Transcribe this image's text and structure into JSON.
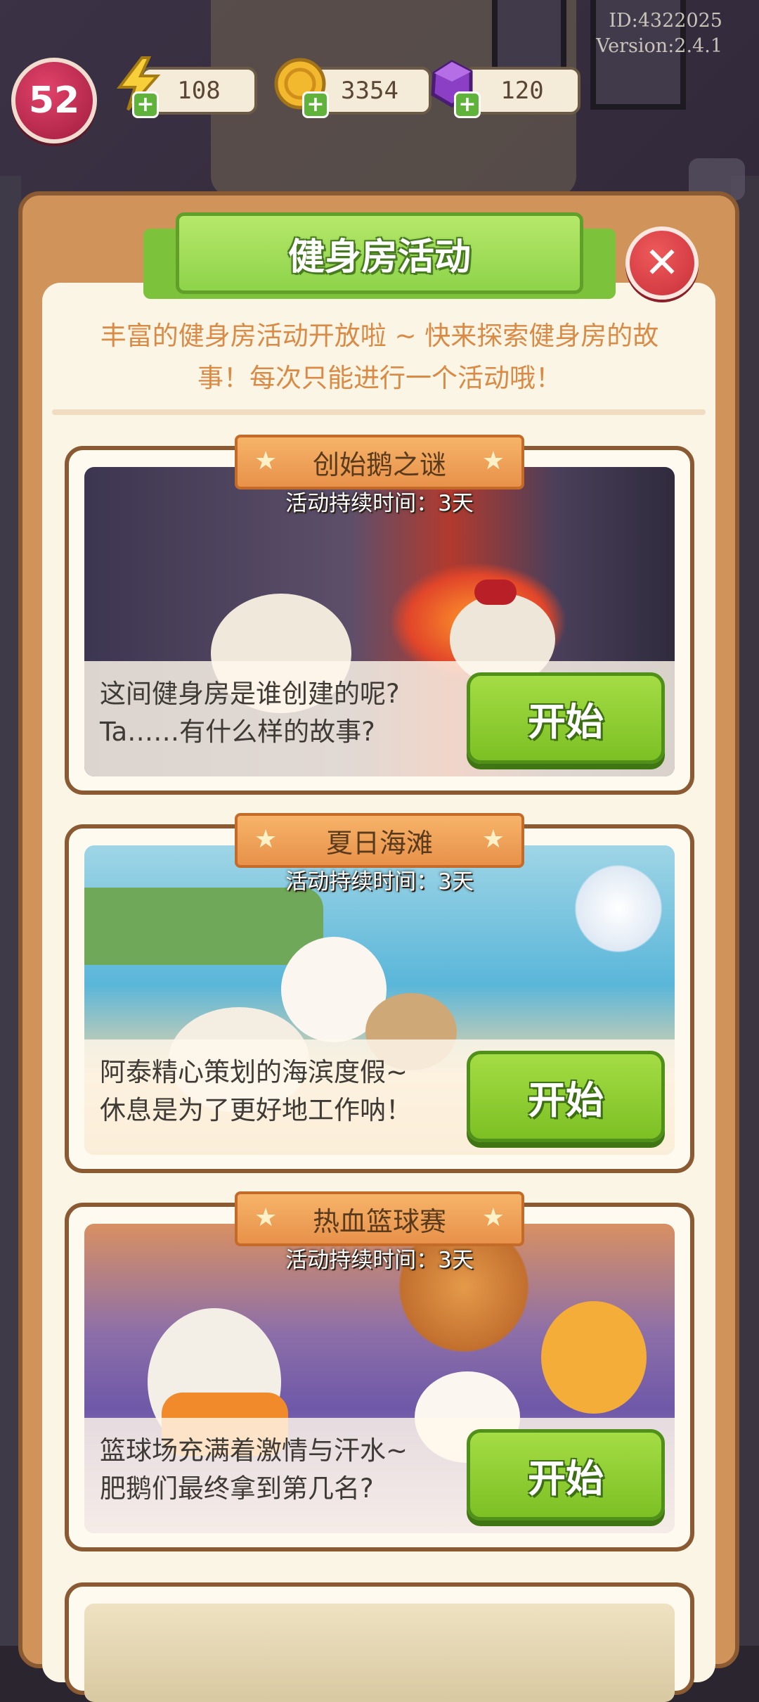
{
  "meta": {
    "id": "ID:4322025",
    "version": "Version:2.4.1"
  },
  "hud": {
    "level": "52",
    "energy": "108",
    "coins": "3354",
    "gems": "120"
  },
  "dialog": {
    "title": "健身房活动",
    "close_label": "✕",
    "intro_line1": "丰富的健身房活动开放啦 ~ 快来探索健身房的故",
    "intro_line2": "事！每次只能进行一个活动哦！"
  },
  "activities": [
    {
      "name": "创始鹅之谜",
      "duration": "活动持续时间：3天",
      "desc_line1": "这间健身房是谁创建的呢?",
      "desc_line2": "Ta……有什么样的故事?",
      "button": "开始"
    },
    {
      "name": "夏日海滩",
      "duration": "活动持续时间：3天",
      "desc_line1": "阿泰精心策划的海滨度假~",
      "desc_line2": "休息是为了更好地工作呐！",
      "button": "开始"
    },
    {
      "name": "热血篮球赛",
      "duration": "活动持续时间：3天",
      "desc_line1": "篮球场充满着激情与汗水~",
      "desc_line2": "肥鹅们最终拿到第几名?",
      "button": "开始"
    }
  ],
  "colors": {
    "dialog_frame": "#d0945a",
    "panel": "#fbf5e6",
    "intro_text": "#d98a45",
    "start_button": "#8ed03a",
    "tag": "#f0a35a"
  }
}
